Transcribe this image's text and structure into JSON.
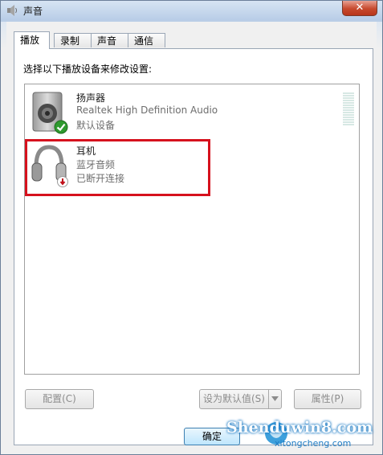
{
  "window": {
    "title": "声音"
  },
  "tabs": [
    {
      "label": "播放",
      "active": true
    },
    {
      "label": "录制",
      "active": false
    },
    {
      "label": "声音",
      "active": false
    },
    {
      "label": "通信",
      "active": false
    }
  ],
  "panel": {
    "instruction": "选择以下播放设备来修改设置:"
  },
  "devices": [
    {
      "name": "扬声器",
      "description": "Realtek High Definition Audio",
      "status": "默认设备",
      "icon": "speaker-icon",
      "badge": "default-check"
    },
    {
      "name": "耳机",
      "description": "蓝牙音频",
      "status": "已断开连接",
      "icon": "headphones-icon",
      "badge": "disconnected-arrow"
    }
  ],
  "buttons": {
    "configure": "配置(C)",
    "set_default": "设为默认值(S)",
    "properties": "属性(P)",
    "ok": "确定"
  },
  "watermark": {
    "brand": "Shenduwin8.com",
    "sub": "xitongcheng.com"
  },
  "colors": {
    "highlight": "#d6111d",
    "check_green": "#2e9a2e"
  }
}
